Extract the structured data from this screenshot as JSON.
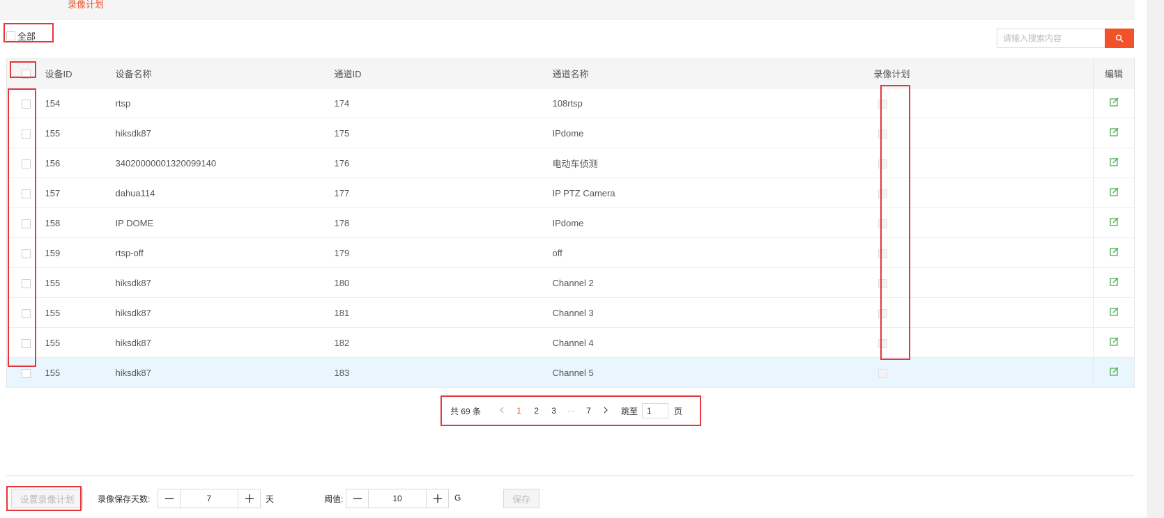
{
  "header": {
    "active_tab": "录像计划"
  },
  "filter": {
    "all_label": "全部"
  },
  "search": {
    "placeholder": "请输入搜索内容"
  },
  "table": {
    "headers": [
      "设备ID",
      "设备名称",
      "通道ID",
      "通道名称",
      "录像计划",
      "编辑"
    ],
    "rows": [
      {
        "device_id": "154",
        "device_name": "rtsp",
        "channel_id": "174",
        "channel_name": "108rtsp"
      },
      {
        "device_id": "155",
        "device_name": "hiksdk87",
        "channel_id": "175",
        "channel_name": "IPdome"
      },
      {
        "device_id": "156",
        "device_name": "34020000001320099140",
        "channel_id": "176",
        "channel_name": "电动车侦测"
      },
      {
        "device_id": "157",
        "device_name": "dahua114",
        "channel_id": "177",
        "channel_name": "IP PTZ Camera"
      },
      {
        "device_id": "158",
        "device_name": "IP DOME",
        "channel_id": "178",
        "channel_name": "IPdome"
      },
      {
        "device_id": "159",
        "device_name": "rtsp-off",
        "channel_id": "179",
        "channel_name": "off"
      },
      {
        "device_id": "155",
        "device_name": "hiksdk87",
        "channel_id": "180",
        "channel_name": "Channel 2"
      },
      {
        "device_id": "155",
        "device_name": "hiksdk87",
        "channel_id": "181",
        "channel_name": "Channel 3"
      },
      {
        "device_id": "155",
        "device_name": "hiksdk87",
        "channel_id": "182",
        "channel_name": "Channel 4"
      },
      {
        "device_id": "155",
        "device_name": "hiksdk87",
        "channel_id": "183",
        "channel_name": "Channel 5"
      }
    ]
  },
  "pagination": {
    "total_label": "共 69 条",
    "prev_icon": "chevron-left-icon",
    "pages": [
      "1",
      "2",
      "3"
    ],
    "ellipsis": "···",
    "last_page": "7",
    "next_icon": "chevron-right-icon",
    "jump_label": "跳至",
    "jump_value": "1",
    "page_suffix": "页"
  },
  "bottom": {
    "set_plan_label": "设置录像计划",
    "days_label": "录像保存天数:",
    "days_value": "7",
    "days_unit": "天",
    "threshold_label": "阈值:",
    "threshold_value": "10",
    "threshold_unit": "G",
    "save_label": "保存"
  },
  "colors": {
    "accent": "#f2512a",
    "highlight": "#e5363b",
    "edit_icon": "#4caf50",
    "row_selected": "#eaf6fd"
  }
}
